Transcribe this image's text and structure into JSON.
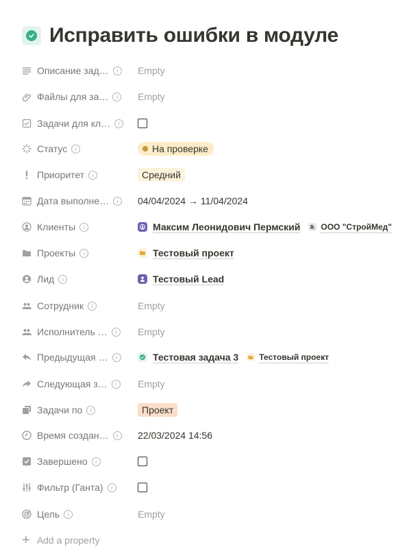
{
  "page": {
    "title": "Исправить ошибки в модуле",
    "icon": "check-circle-icon",
    "accent": "#38b08a"
  },
  "properties": [
    {
      "label": "Описание зад…",
      "icon": "text-lines-icon",
      "value": "Empty"
    },
    {
      "label": "Файлы для за…",
      "icon": "paperclip-icon",
      "value": "Empty"
    },
    {
      "label": "Задачи для кл…",
      "icon": "checkbox-icon",
      "value": "unchecked"
    },
    {
      "label": "Статус",
      "icon": "status-spinner-icon",
      "value": "На проверке"
    },
    {
      "label": "Приоритет",
      "icon": "exclamation-icon",
      "value": "Средний"
    },
    {
      "label": "Дата выполне…",
      "icon": "calendar-icon",
      "value": "04/04/2024 → 11/04/2024"
    },
    {
      "label": "Клиенты",
      "icon": "person-circle-icon",
      "values": [
        "Максим Леонидович Пермский",
        "ООО \"СтройМед\""
      ]
    },
    {
      "label": "Проекты",
      "icon": "folder-icon",
      "value": "Тестовый проект"
    },
    {
      "label": "Лид",
      "icon": "person-circle-icon",
      "value": "Тестовый Lead"
    },
    {
      "label": "Сотрудник",
      "icon": "people-icon",
      "value": "Empty"
    },
    {
      "label": "Исполнитель …",
      "icon": "people-icon",
      "value": "Empty"
    },
    {
      "label": "Предыдущая …",
      "icon": "reply-arrow-icon",
      "values": [
        "Тестовая задача 3",
        "Тестовый проект"
      ]
    },
    {
      "label": "Следующая з…",
      "icon": "forward-arrow-icon",
      "value": "Empty"
    },
    {
      "label": "Задачи по",
      "icon": "stacked-squares-icon",
      "value": "Проект"
    },
    {
      "label": "Время создан…",
      "icon": "clock-icon",
      "value": "22/03/2024 14:56"
    },
    {
      "label": "Завершено",
      "icon": "checkbox-checked-icon",
      "value": "unchecked"
    },
    {
      "label": "Фильтр (Ганта)",
      "icon": "sliders-icon",
      "value": "unchecked"
    },
    {
      "label": "Цель",
      "icon": "target-icon",
      "value": "Empty"
    }
  ],
  "add_property": "Add a property",
  "colors": {
    "status_bg": "#fdecc8",
    "status_dot": "#c89540",
    "priority_bg": "#fbf3db",
    "tag_orange_bg": "#fadec9",
    "person_icon_bg": "#6b62b0"
  }
}
